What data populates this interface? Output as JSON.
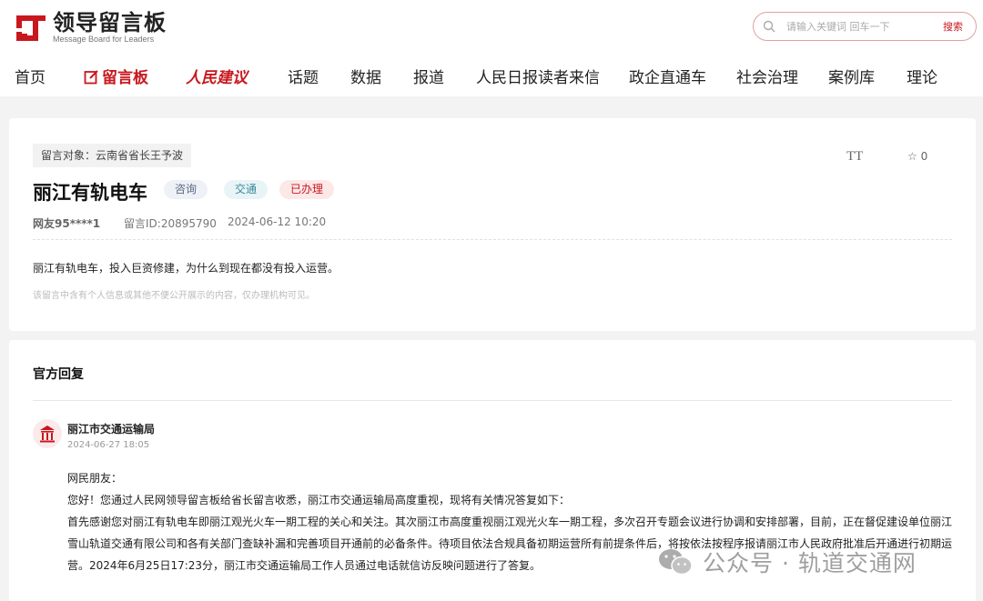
{
  "header": {
    "logo_title": "领导留言板",
    "logo_subtitle": "Message Board for Leaders",
    "search": {
      "placeholder": "请输入关键词 回车一下",
      "button": "搜索"
    }
  },
  "nav": {
    "items": [
      {
        "label": "首页"
      },
      {
        "label": "留言板"
      },
      {
        "label": "人民建议"
      },
      {
        "label": "话题"
      },
      {
        "label": "数据"
      },
      {
        "label": "报道"
      },
      {
        "label": "人民日报读者来信"
      },
      {
        "label": "政企直通车"
      },
      {
        "label": "社会治理"
      },
      {
        "label": "案例库"
      },
      {
        "label": "理论"
      }
    ]
  },
  "message": {
    "target": "留言对象：云南省省长王予波",
    "font_toggle": "TT",
    "favorite_count": "0",
    "title": "丽江有轨电车",
    "tags": {
      "type": "咨询",
      "category": "交通",
      "status": "已办理"
    },
    "user": "网友95****1",
    "message_id": "留言ID:20895790",
    "datetime": "2024-06-12 10:20",
    "content": "丽江有轨电车，投入巨资修建，为什么到现在都没有投入运营。",
    "privacy_note": "该留言中含有个人信息或其他不便公开展示的内容，仅办理机构可见。"
  },
  "reply": {
    "heading": "官方回复",
    "org_name": "丽江市交通运输局",
    "datetime": "2024-06-27 18:05",
    "paragraphs": [
      "网民朋友：",
      "您好！您通过人民网领导留言板给省长留言收悉，丽江市交通运输局高度重视，现将有关情况答复如下：",
      "首先感谢您对丽江有轨电车即丽江观光火车一期工程的关心和关注。其次丽江市高度重视丽江观光火车一期工程，多次召开专题会议进行协调和安排部署，目前，正在督促建设单位丽江雪山轨道交通有限公司和各有关部门查缺补漏和完善项目开通前的必备条件。待项目依法合规具备初期运营所有前提条件后，将按依法按程序报请丽江市人民政府批准后开通进行初期运营。2024年6月25日17:23分，丽江市交通运输局工作人员通过电话就信访反映问题进行了答复。"
    ]
  },
  "watermark": {
    "text": "公众号 · 轨道交通网"
  },
  "colors": {
    "brand_red": "#c8181e",
    "page_bg": "#f3f3f3"
  }
}
